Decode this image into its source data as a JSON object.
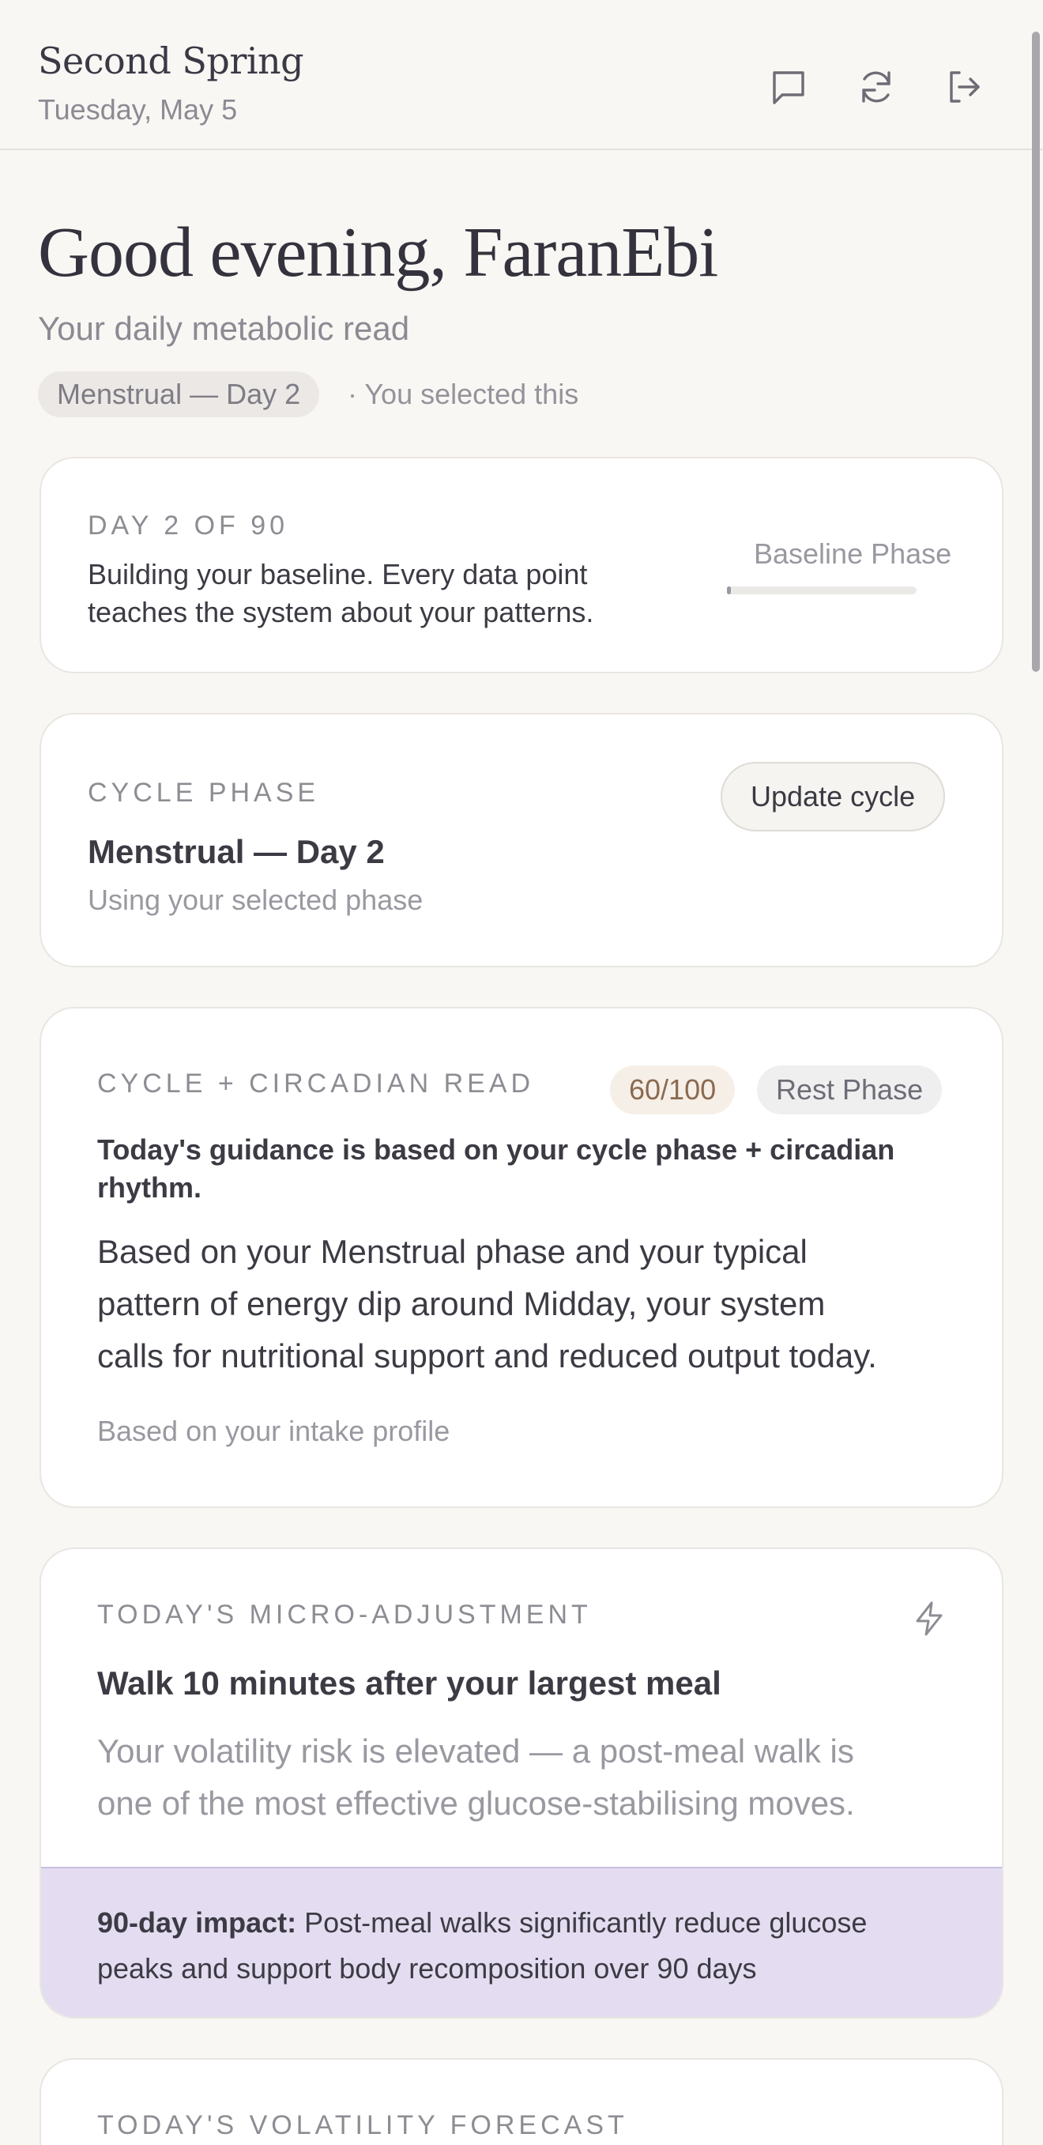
{
  "header": {
    "brand": "Second Spring",
    "date": "Tuesday, May 5",
    "icons": [
      "chat-icon",
      "refresh-icon",
      "logout-icon"
    ]
  },
  "greeting": {
    "title": "Good evening, FaranEbi",
    "subtitle": "Your daily metabolic read",
    "phase_chip": "Menstrual — Day 2",
    "phase_note": "· You selected this"
  },
  "baseline_card": {
    "eyebrow": "DAY 2 OF 90",
    "text_line1": "Building your baseline. Every data point",
    "text_line2": "teaches the system about your patterns.",
    "phase_label": "Baseline Phase",
    "progress_fraction": 0.022
  },
  "cycle_card": {
    "eyebrow": "CYCLE PHASE",
    "phase": "Menstrual — Day 2",
    "note": "Using your selected phase",
    "button": "Update cycle"
  },
  "circadian_card": {
    "eyebrow": "CYCLE + CIRCADIAN READ",
    "score": "60/100",
    "phase_badge": "Rest Phase",
    "guidance_line1": "Today's guidance is based on your cycle phase + circadian",
    "guidance_line2": "rhythm.",
    "body_line1": "Based on your Menstrual phase and your typical",
    "body_line2": "pattern of energy dip around Midday, your system",
    "body_line3": "calls for nutritional support and reduced output today.",
    "source": "Based on your intake profile",
    "colors": {
      "score_bg": "#f6efe7",
      "score_text": "#8b6a50",
      "badge_bg": "#f0eff0"
    }
  },
  "micro_card": {
    "eyebrow": "TODAY'S MICRO-ADJUSTMENT",
    "icon": "lightning-icon",
    "title": "Walk 10 minutes after your largest meal",
    "body_line1": "Your volatility risk is elevated — a post-meal walk is",
    "body_line2": "one of the most effective glucose-stabilising moves.",
    "impact_label": "90-day impact:",
    "impact_line1": " Post-meal walks significantly reduce glucose",
    "impact_line2": "peaks and support body recomposition over 90 days",
    "colors": {
      "impact_bg": "#e4dcf1"
    }
  },
  "forecast_card": {
    "eyebrow": "TODAY'S VOLATILITY FORECAST"
  }
}
